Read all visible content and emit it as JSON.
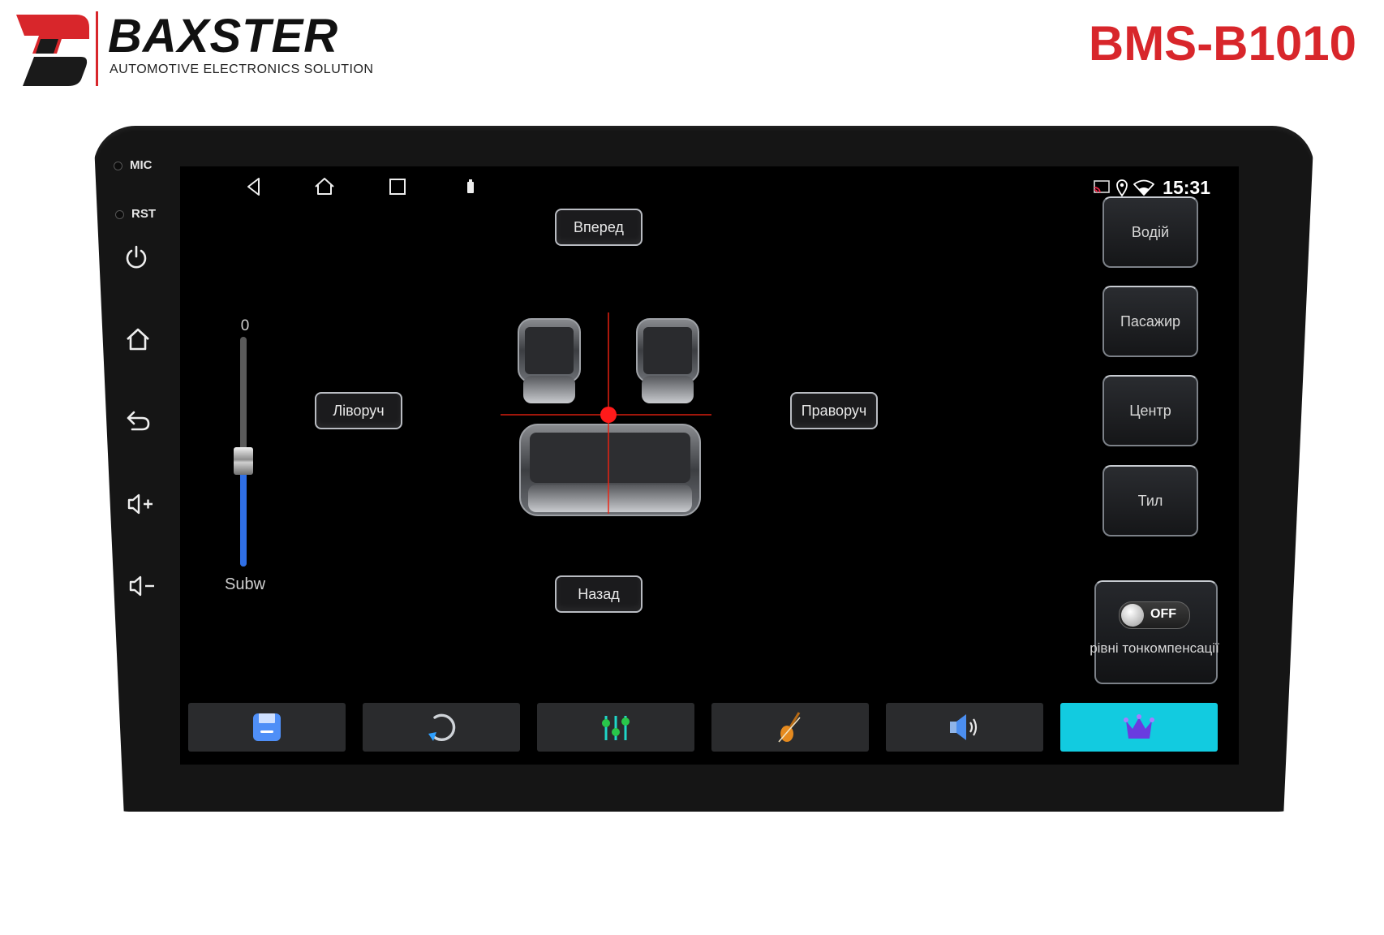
{
  "brand": {
    "name": "BAXSTER",
    "tagline": "AUTOMOTIVE ELECTRONICS SOLUTION",
    "model": "BMS-B1010",
    "accent_color": "#d8262b"
  },
  "bezel": {
    "mic_label": "MIC",
    "rst_label": "RST",
    "icons": [
      "power-icon",
      "home-icon",
      "back-icon",
      "volume-up-icon",
      "volume-down-icon"
    ]
  },
  "status_bar": {
    "nav_icons": [
      "back-triangle-icon",
      "home-icon",
      "recents-square-icon",
      "usb-icon"
    ],
    "status_icons": [
      "cast-icon",
      "location-icon",
      "wifi-icon"
    ],
    "time": "15:31"
  },
  "balance": {
    "forward_label": "Вперед",
    "back_label": "Назад",
    "left_label": "Ліворуч",
    "right_label": "Праворуч",
    "focus_point_color": "#ff1a1a"
  },
  "subwoofer": {
    "value": "0",
    "label": "Subw",
    "level_fraction": 0.46,
    "fill_color": "#2f6fe6"
  },
  "presets": {
    "driver_label": "Водій",
    "passenger_label": "Пасажир",
    "center_label": "Центр",
    "rear_label": "Тил"
  },
  "loudness": {
    "state": "OFF",
    "label": "рівні тонкомпенсації"
  },
  "tabs": [
    {
      "icon": "save-icon",
      "active": false
    },
    {
      "icon": "reset-icon",
      "active": false
    },
    {
      "icon": "equalizer-icon",
      "active": false
    },
    {
      "icon": "violin-icon",
      "active": false
    },
    {
      "icon": "speaker-icon",
      "active": false
    },
    {
      "icon": "crown-icon",
      "active": true
    }
  ],
  "tab_active_color": "#12cbe0"
}
